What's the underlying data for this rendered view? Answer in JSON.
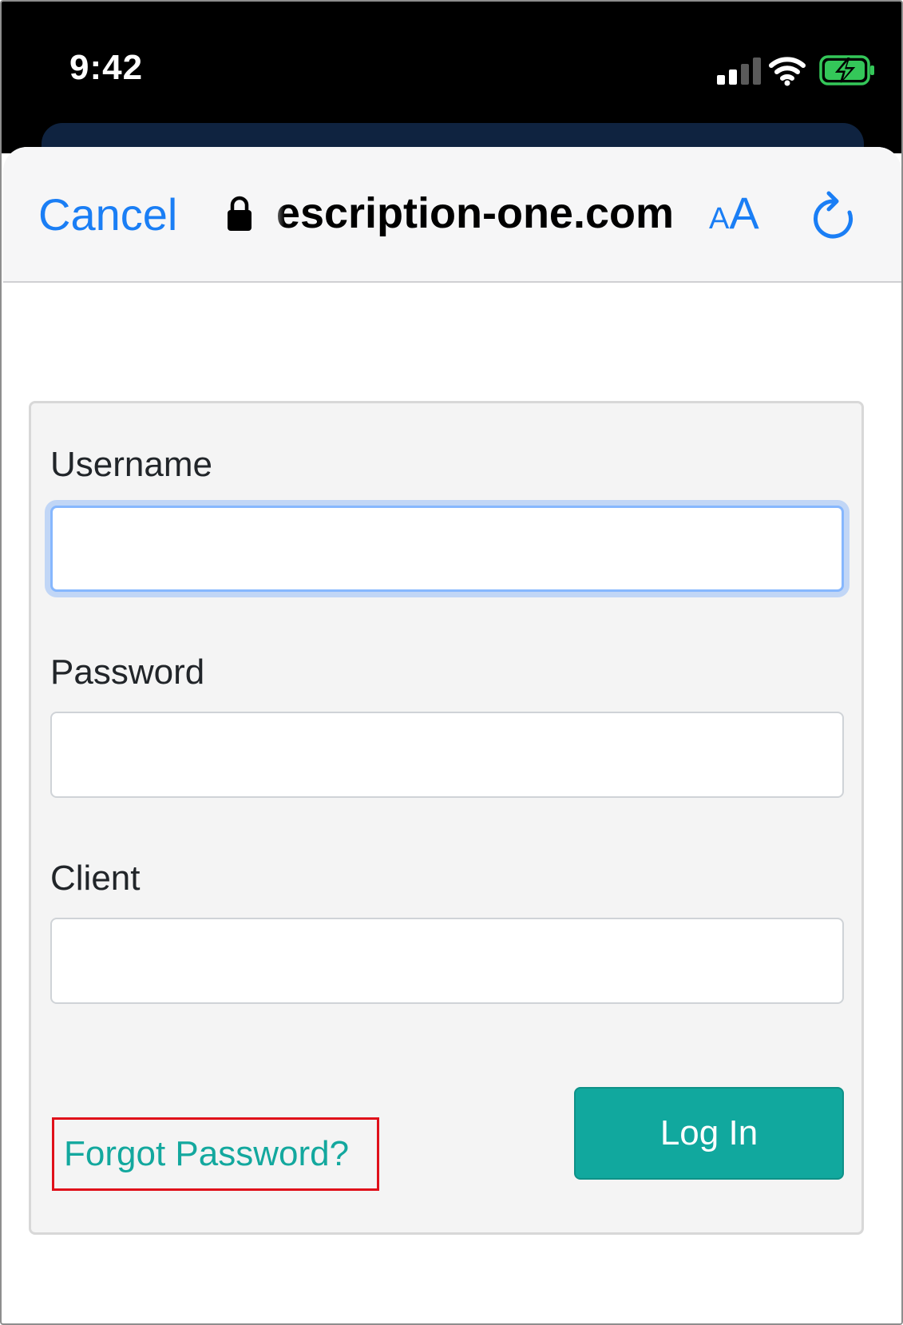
{
  "status_bar": {
    "time": "9:42",
    "icons": [
      "cellular-signal-icon",
      "wifi-icon",
      "battery-charging-icon"
    ],
    "battery_color": "#34c759"
  },
  "browser_bar": {
    "cancel_label": "Cancel",
    "url": "escription-one.com",
    "text_size_small": "A",
    "text_size_big": "A",
    "accent_color": "#1a7ef5",
    "icons": [
      "lock-icon",
      "reload-icon"
    ]
  },
  "login_form": {
    "username": {
      "label": "Username",
      "value": ""
    },
    "password": {
      "label": "Password",
      "value": ""
    },
    "client": {
      "label": "Client",
      "value": ""
    },
    "forgot_password_label": "Forgot Password?",
    "login_button_label": "Log In",
    "accent_color": "#11a89e",
    "highlight_color": "#e0101a"
  }
}
